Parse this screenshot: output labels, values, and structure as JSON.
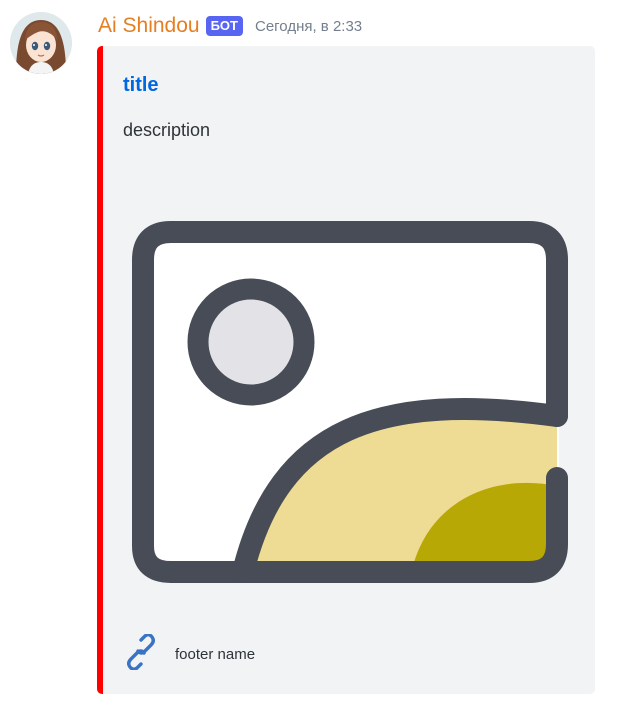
{
  "message": {
    "author": "Ai Shindou",
    "bot_tag": "БОТ",
    "timestamp": "Сегодня, в 2:33"
  },
  "embed": {
    "accent_color": "#ff0000",
    "title": "title",
    "description": "description",
    "image_icon": "image-placeholder-icon",
    "footer": {
      "icon": "link-icon",
      "text": "footer name"
    }
  },
  "colors": {
    "username": "#e67e22",
    "bot_tag_bg": "#5865f2",
    "title_link": "#0068e0",
    "embed_bg": "#f2f3f5"
  }
}
